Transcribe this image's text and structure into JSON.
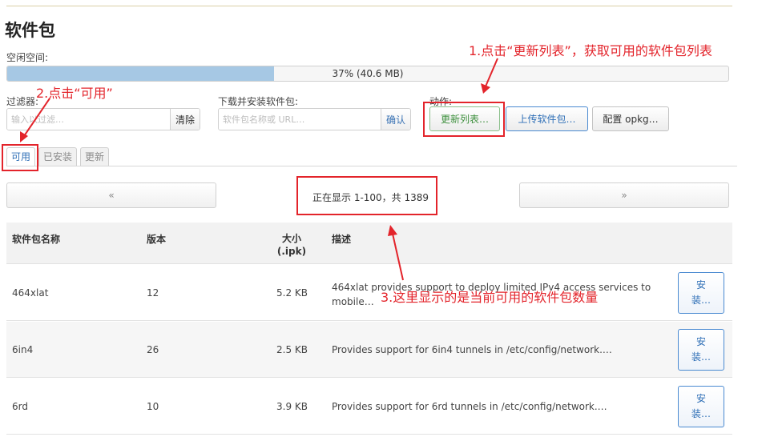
{
  "page": {
    "title": "软件包"
  },
  "space": {
    "label": "空闲空间:",
    "percent": 37,
    "text": "37% (40.6 MB)"
  },
  "filter": {
    "label": "过滤器:",
    "placeholder": "输入以过滤…",
    "clear_label": "清除"
  },
  "download": {
    "label": "下载并安装软件包:",
    "placeholder": "软件包名称或 URL…",
    "confirm_label": "确认"
  },
  "actions": {
    "label": "动作:",
    "update_label": "更新列表…",
    "upload_label": "上传软件包…",
    "configure_label": "配置 opkg…"
  },
  "tabs": [
    {
      "label": "可用",
      "active": true
    },
    {
      "label": "已安装",
      "active": false
    },
    {
      "label": "更新",
      "active": false
    }
  ],
  "pager": {
    "prev": "«",
    "next": "»",
    "status": "正在显示 1-100，共 1389"
  },
  "table": {
    "headers": {
      "name": "软件包名称",
      "version": "版本",
      "size": "大小 (.ipk)",
      "description": "描述"
    },
    "rows": [
      {
        "name": "464xlat",
        "version": "12",
        "size": "5.2 KB",
        "description_line1": "464xlat provides support to deploy limited IPv4 access services to",
        "description_line2": "mobile…",
        "install_l1": "安",
        "install_l2": "装…"
      },
      {
        "name": "6in4",
        "version": "26",
        "size": "2.5 KB",
        "description_line1": "Provides support for 6in4 tunnels in /etc/config/network.…",
        "description_line2": "",
        "install_l1": "安",
        "install_l2": "装…"
      },
      {
        "name": "6rd",
        "version": "10",
        "size": "3.9 KB",
        "description_line1": "Provides support for 6rd tunnels in /etc/config/network.…",
        "description_line2": "",
        "install_l1": "安",
        "install_l2": "装…"
      }
    ]
  },
  "annotations": {
    "step1": "1.点击“更新列表”，获取可用的软件包列表",
    "step2": "2.点击“可用”",
    "step3": "3.这里显示的是当前可用的软件包数量"
  },
  "colors": {
    "annotation": "#e3242b",
    "progress_fill": "#a6c8e4",
    "action_blue": "#2f6fb6",
    "positive_green": "#3d8f3d"
  }
}
